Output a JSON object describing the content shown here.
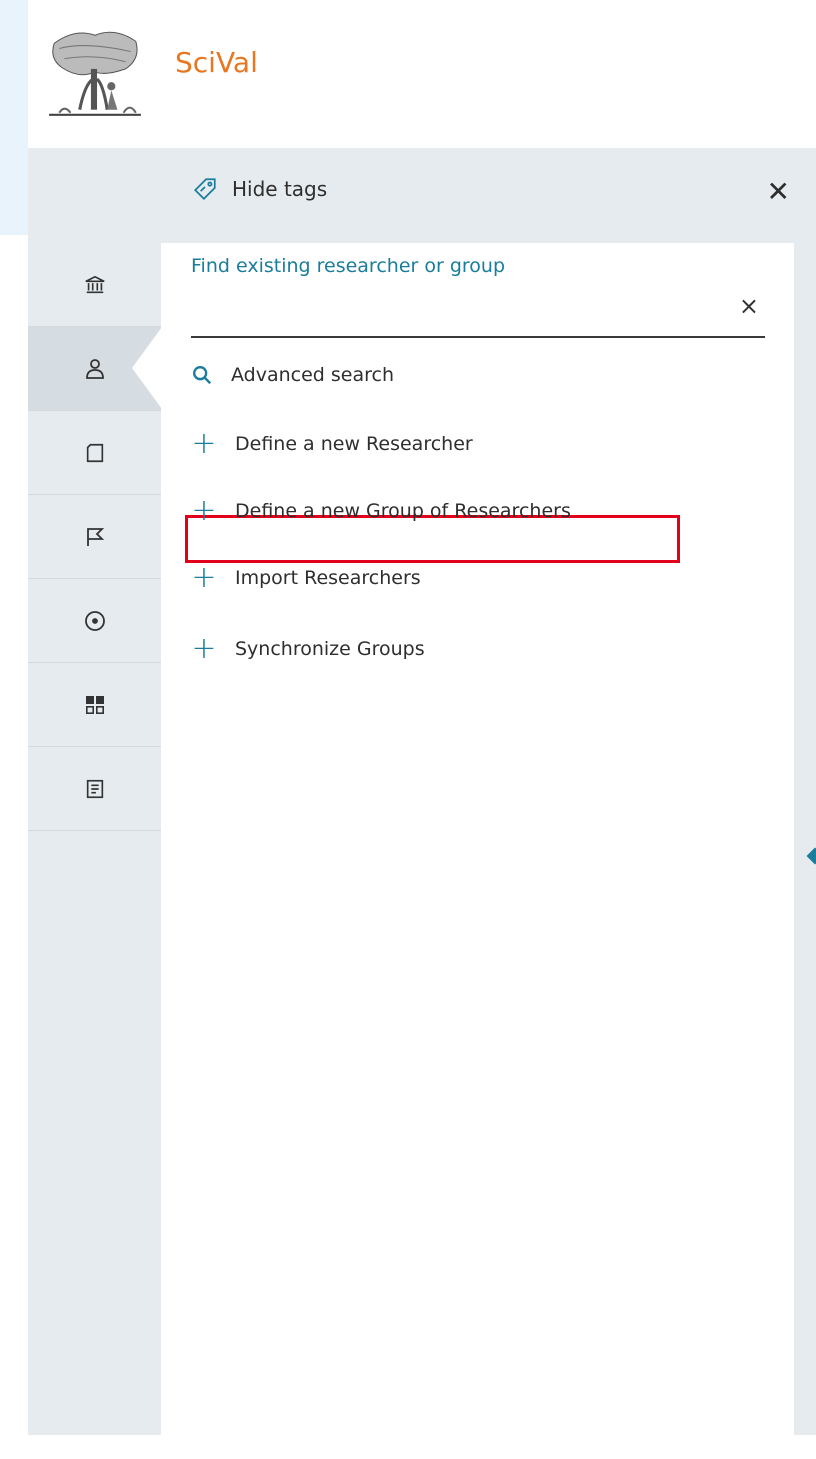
{
  "header": {
    "brand": "SciVal",
    "logo_icon": "elsevier-tree-logo"
  },
  "panel": {
    "hide_tags_label": "Hide tags",
    "close_icon": "close-icon"
  },
  "rail": [
    {
      "icon": "institution-icon"
    },
    {
      "icon": "researcher-icon",
      "active": true
    },
    {
      "icon": "publication-icon"
    },
    {
      "icon": "flag-icon"
    },
    {
      "icon": "topic-icon"
    },
    {
      "icon": "dashboard-icon"
    },
    {
      "icon": "report-icon"
    }
  ],
  "search": {
    "label": "Find existing researcher or group",
    "value": "",
    "clear_glyph": "×"
  },
  "actions": {
    "advanced_search": "Advanced search",
    "define_researcher": "Define a new Researcher",
    "define_group": "Define a new Group of Researchers",
    "import_researchers": "Import Researchers",
    "synchronize_groups": "Synchronize Groups"
  },
  "colors": {
    "accent": "#1a7d9b",
    "brand": "#e87722",
    "highlight": "#e3001b"
  }
}
